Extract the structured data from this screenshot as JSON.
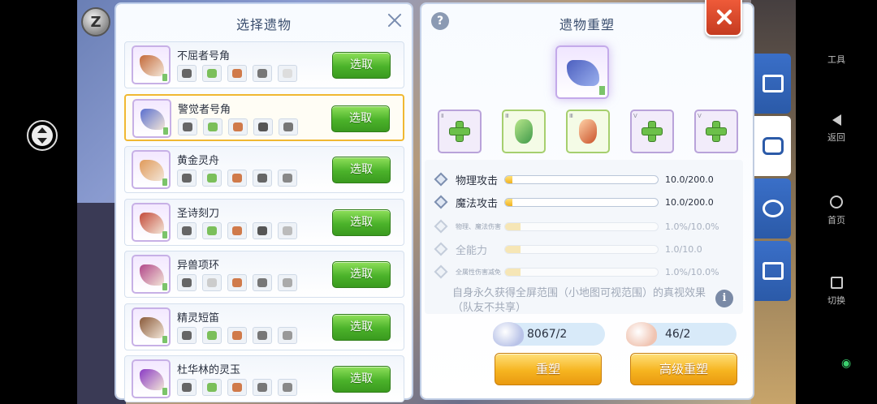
{
  "left_panel": {
    "title": "选择遗物",
    "items": [
      {
        "name": "不屈者号角",
        "button": "选取",
        "color": "#c46a3a",
        "minis": [
          "#666",
          "#7bbf5a",
          "#d07a4a",
          "#777",
          "#ddd"
        ]
      },
      {
        "name": "警觉者号角",
        "button": "选取",
        "color": "#5a6fcf",
        "minis": [
          "#666",
          "#7bbf5a",
          "#d07a4a",
          "#555",
          "#777"
        ]
      },
      {
        "name": "黄金灵舟",
        "button": "选取",
        "color": "#e09a5a",
        "minis": [
          "#666",
          "#7bbf5a",
          "#d07a4a",
          "#666",
          "#888"
        ]
      },
      {
        "name": "圣诗刻刀",
        "button": "选取",
        "color": "#c44a3a",
        "minis": [
          "#666",
          "#7bbf5a",
          "#d07a4a",
          "#555",
          "#bbb"
        ]
      },
      {
        "name": "异兽项环",
        "button": "选取",
        "color": "#b2478a",
        "minis": [
          "#666",
          "#ccc",
          "#d07a4a",
          "#777",
          "#aaa"
        ]
      },
      {
        "name": "精灵短笛",
        "button": "选取",
        "color": "#8a5a3a",
        "minis": [
          "#666",
          "#7bbf5a",
          "#d07a4a",
          "#777",
          "#999"
        ]
      },
      {
        "name": "杜华林的灵玉",
        "button": "选取",
        "color": "#8a3ac4",
        "minis": [
          "#666",
          "#7bbf5a",
          "#d07a4a",
          "#777",
          "#888"
        ]
      }
    ]
  },
  "right_panel": {
    "title": "遗物重塑",
    "help_icon": "?",
    "stats": [
      {
        "label": "物理攻击",
        "value": "10.0/200.0",
        "fill": 0.05
      },
      {
        "label": "魔法攻击",
        "value": "10.0/200.0",
        "fill": 0.05
      },
      {
        "label": "物理、魔法伤害",
        "value": "1.0%/10.0%",
        "fill": 0.1
      },
      {
        "label": "全能力",
        "value": "1.0/10.0",
        "fill": 0.1
      },
      {
        "label": "全属性伤害减免",
        "value": "1.0%/10.0%",
        "fill": 0.1
      }
    ],
    "description": "自身永久获得全屏范围（小地图可视范围）的真视效果（队友不共享）",
    "info_icon": "i",
    "costs": [
      "8067/2",
      "46/2"
    ],
    "buttons": {
      "reshape": "重塑",
      "advanced_reshape": "高级重塑"
    }
  },
  "system_nav": {
    "tools": "工具",
    "back": "返回",
    "home": "首页",
    "switch": "切换"
  },
  "coin_label": "Z",
  "colors": {
    "pick_button": "#4bb22a",
    "action_button": "#f6b420",
    "close_red": "#d8462a",
    "tab_blue": "#2b5aa8"
  }
}
